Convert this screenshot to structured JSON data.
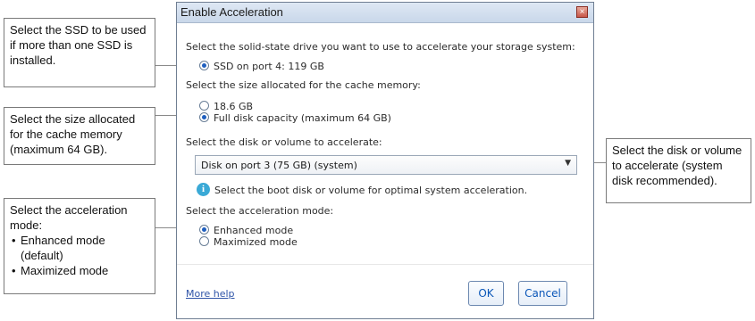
{
  "callouts": {
    "ssd": "Select the SSD to be used if more than one SSD is installed.",
    "size": "Select the size allocated for the cache memory (maximum 64 GB).",
    "mode_intro": "Select the acceleration mode:",
    "mode_items": [
      "Enhanced mode (default)",
      "Maximized mode"
    ],
    "disk": "Select the disk or volume to accelerate (system disk recommended)."
  },
  "dialog": {
    "title": "Enable Acceleration",
    "close_icon": "close-icon",
    "ssd_prompt": "Select the solid-state drive you want to use to accelerate your storage system:",
    "ssd_option": "SSD on port 4: 119 GB",
    "size_prompt": "Select the size allocated for the cache memory:",
    "size_options": [
      "18.6 GB",
      "Full disk capacity (maximum 64 GB)"
    ],
    "disk_prompt": "Select the disk or volume to accelerate:",
    "disk_selected": "Disk on port 3 (75 GB) (system)",
    "info_text": "Select the boot disk or volume for optimal system acceleration.",
    "mode_prompt": "Select the acceleration mode:",
    "mode_options": [
      "Enhanced mode",
      "Maximized mode"
    ],
    "more_help": "More help",
    "ok": "OK",
    "cancel": "Cancel"
  }
}
